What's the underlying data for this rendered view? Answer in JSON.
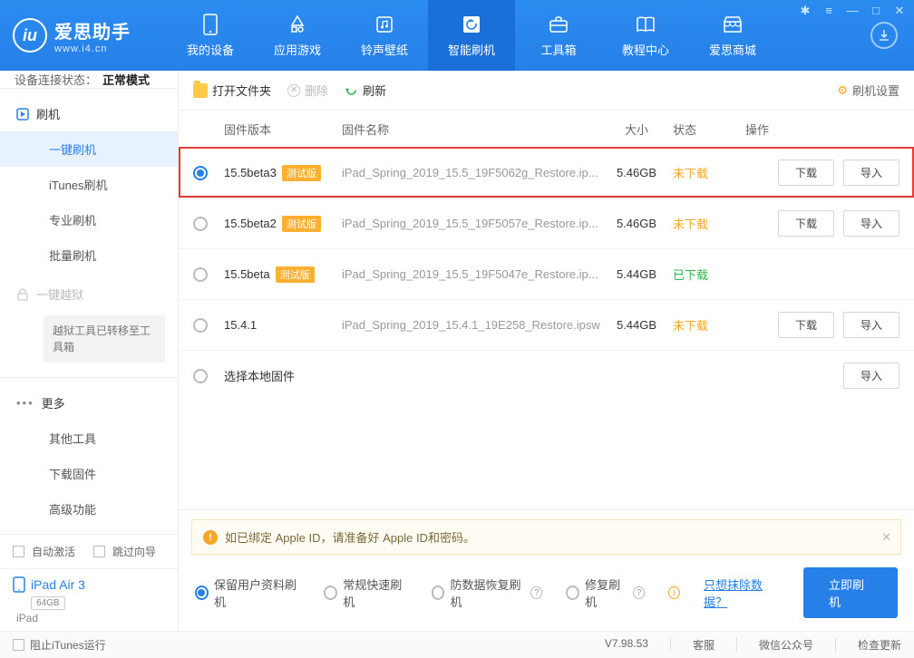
{
  "app": {
    "name": "爱思助手",
    "domain": "www.i4.cn"
  },
  "topnav": [
    "我的设备",
    "应用游戏",
    "铃声壁纸",
    "智能刷机",
    "工具箱",
    "教程中心",
    "爱思商城"
  ],
  "sidebar": {
    "state_label": "设备连接状态：",
    "state_value": "正常模式",
    "heads": {
      "flash": "刷机",
      "more": "更多"
    },
    "flash_items": [
      "一键刷机",
      "iTunes刷机",
      "专业刷机",
      "批量刷机"
    ],
    "jailbreak": "一键越狱",
    "jailbreak_note": "越狱工具已转移至工具箱",
    "more_items": [
      "其他工具",
      "下载固件",
      "高级功能"
    ],
    "auto_activate": "自动激活",
    "skip_guide": "跳过向导",
    "device": {
      "name": "iPad Air 3",
      "capacity": "64GB",
      "type": "iPad"
    }
  },
  "toolbar": {
    "open": "打开文件夹",
    "delete": "删除",
    "refresh": "刷新",
    "settings": "刷机设置"
  },
  "columns": {
    "version": "固件版本",
    "name": "固件名称",
    "size": "大小",
    "status": "状态",
    "action": "操作"
  },
  "rows": [
    {
      "v": "15.5beta3",
      "tag": "测试版",
      "n": "iPad_Spring_2019_15.5_19F5062g_Restore.ip...",
      "s": "5.46GB",
      "st": "未下载",
      "sel": true,
      "dl": true
    },
    {
      "v": "15.5beta2",
      "tag": "测试版",
      "n": "iPad_Spring_2019_15.5_19F5057e_Restore.ip...",
      "s": "5.46GB",
      "st": "未下载",
      "sel": false,
      "dl": true
    },
    {
      "v": "15.5beta",
      "tag": "测试版",
      "n": "iPad_Spring_2019_15.5_19F5047e_Restore.ip...",
      "s": "5.44GB",
      "st": "已下载",
      "sel": false,
      "dl": false
    },
    {
      "v": "15.4.1",
      "tag": "",
      "n": "iPad_Spring_2019_15.4.1_19E258_Restore.ipsw",
      "s": "5.44GB",
      "st": "未下载",
      "sel": false,
      "dl": true
    }
  ],
  "local_select": "选择本地固件",
  "buttons": {
    "download": "下载",
    "import": "导入"
  },
  "warn": "如已绑定 Apple ID，请准备好 Apple ID和密码。",
  "modes": {
    "keep": "保留用户资料刷机",
    "normal": "常规快速刷机",
    "recover": "防数据恢复刷机",
    "repair": "修复刷机",
    "erase_link": "只想抹除数据？",
    "go": "立即刷机"
  },
  "statusbar": {
    "block_itunes": "阻止iTunes运行",
    "version": "V7.98.53",
    "support": "客服",
    "wechat": "微信公众号",
    "update": "检查更新"
  }
}
